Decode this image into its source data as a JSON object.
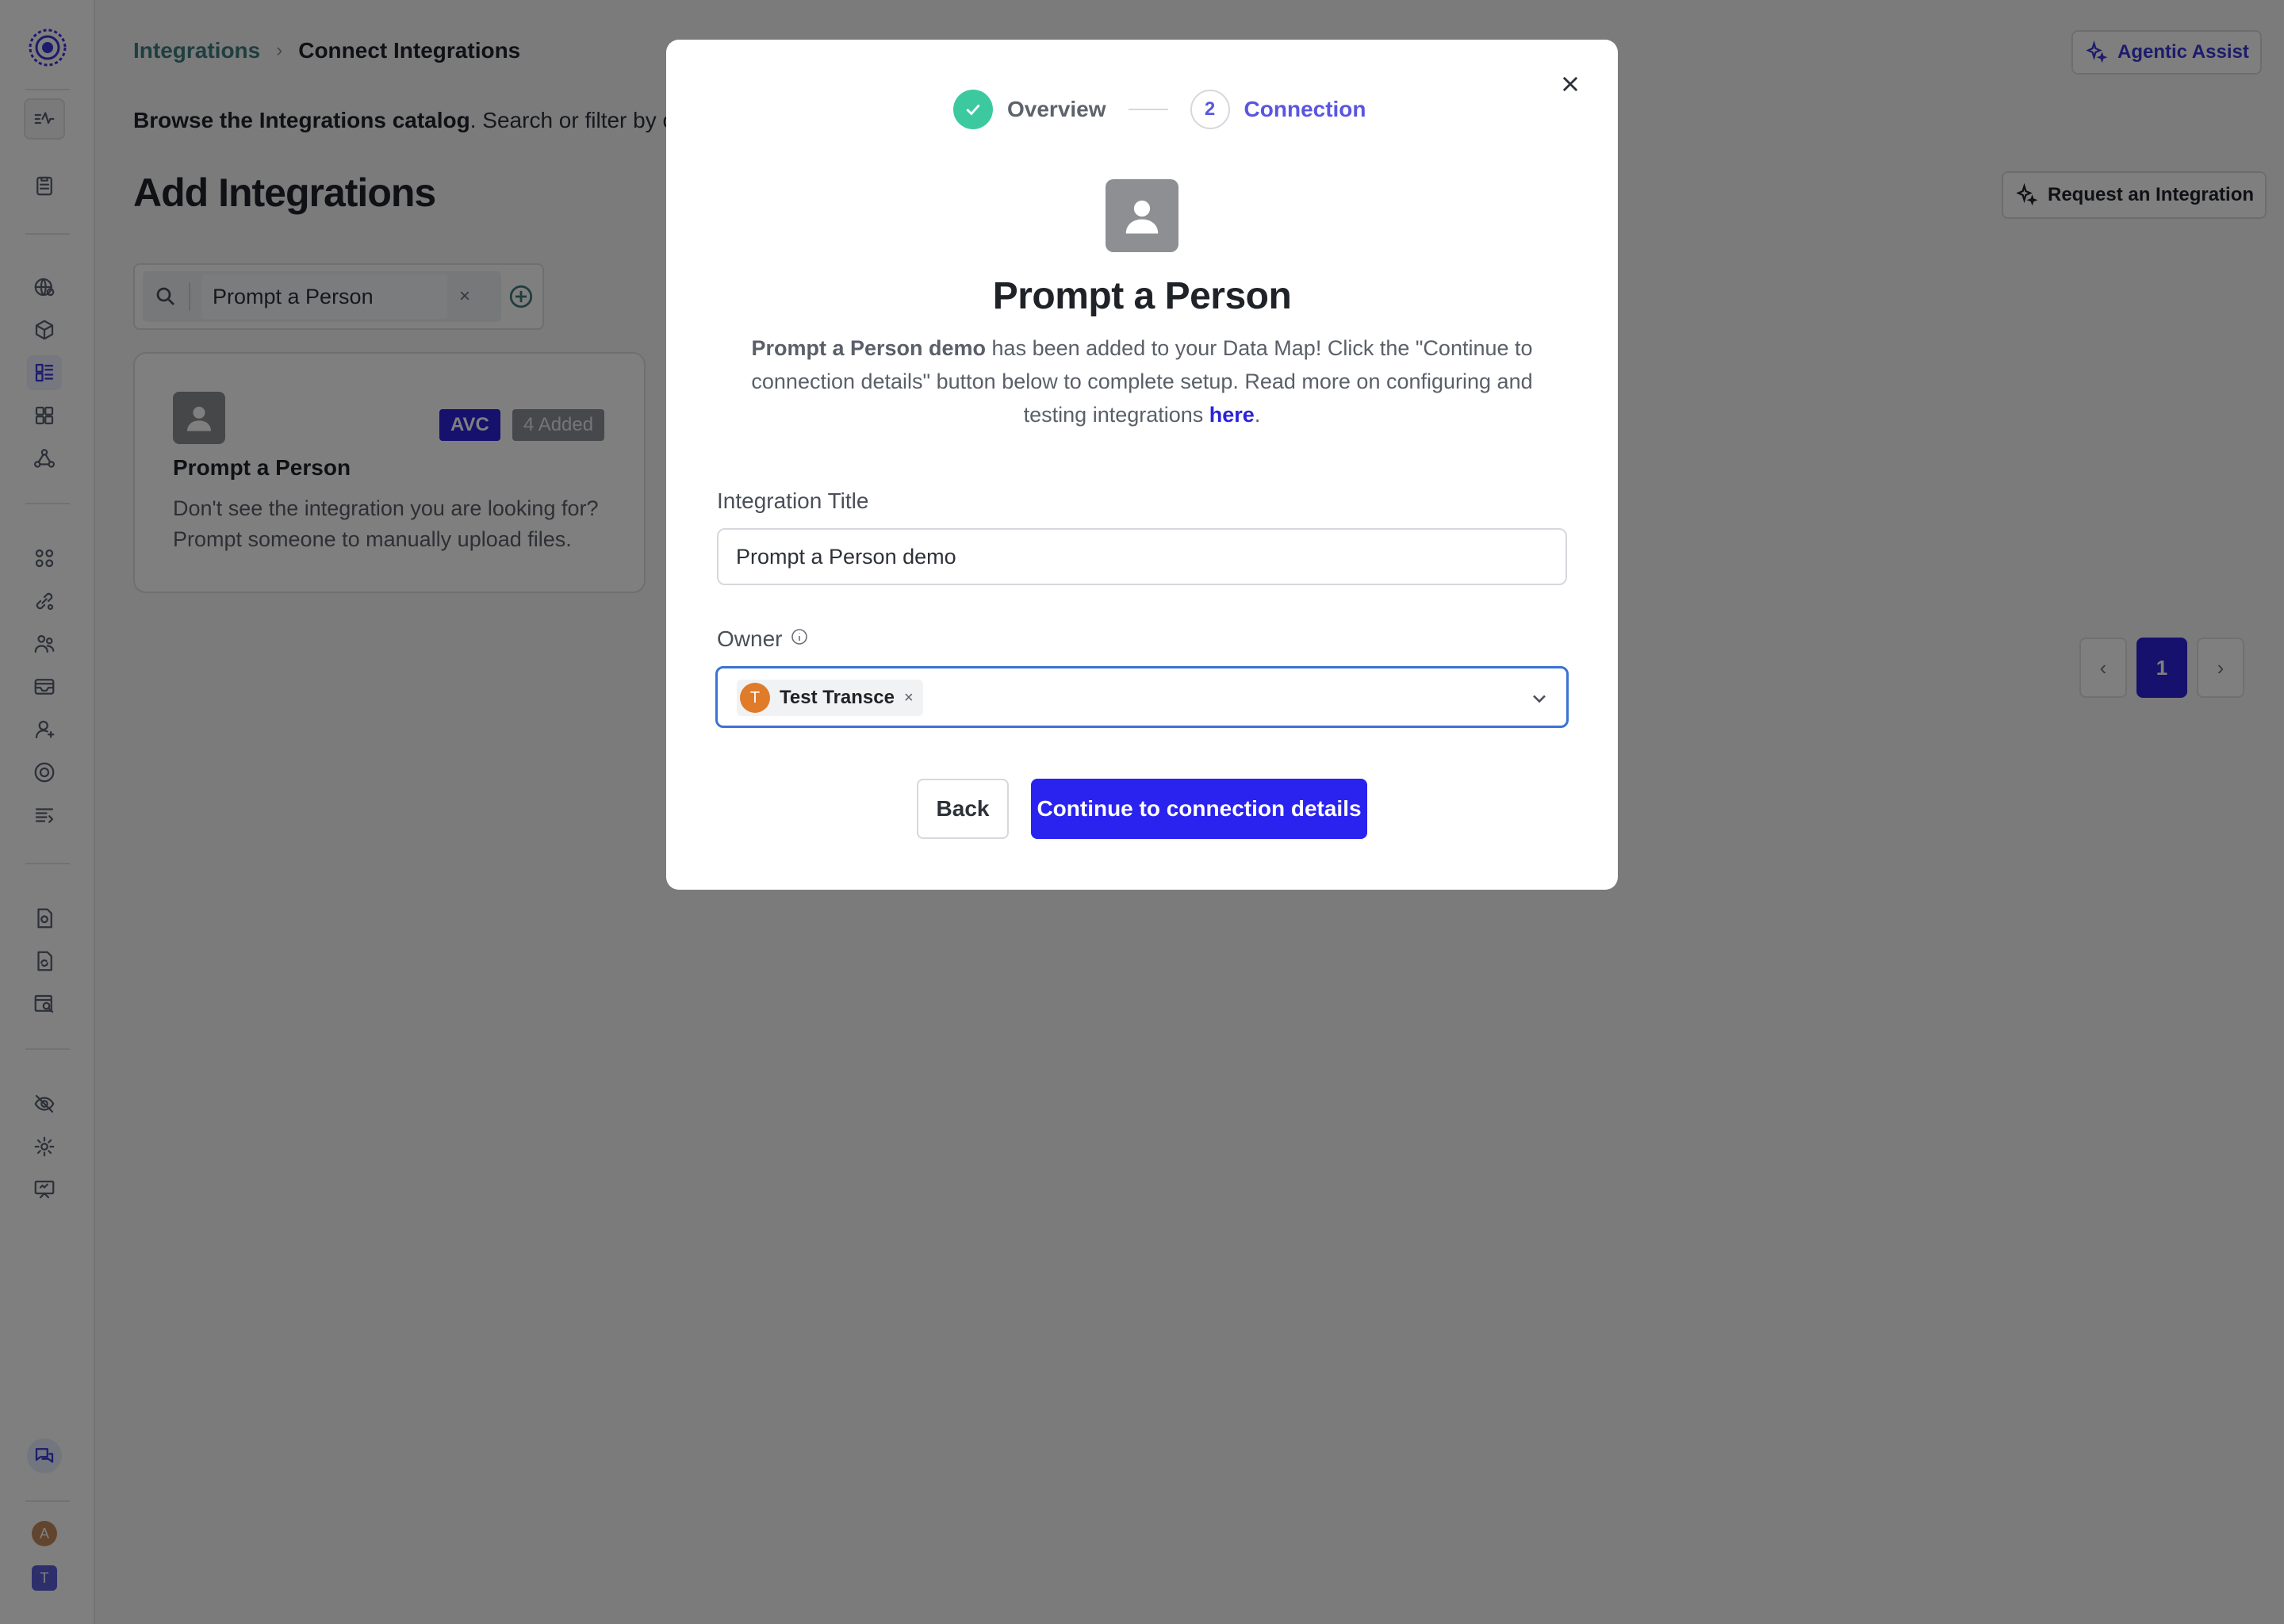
{
  "breadcrumb": {
    "parent": "Integrations",
    "separator": "›",
    "current": "Connect Integrations"
  },
  "header": {
    "agentic_assist_label": "Agentic Assist"
  },
  "intro": {
    "bold": "Browse the Integrations catalog",
    "rest": ". Search or filter by categ"
  },
  "page": {
    "title": "Add Integrations",
    "request_label": "Request an Integration"
  },
  "search": {
    "value": "Prompt a Person",
    "clear_glyph": "×"
  },
  "card": {
    "title": "Prompt a Person",
    "badge_avc": "AVC",
    "badge_added": "4 Added",
    "description": "Don't see the integration you are looking for? Prompt someone to manually upload files."
  },
  "pagination": {
    "prev": "‹",
    "current": "1",
    "next": "›"
  },
  "sidebar": {
    "avatar_a": "A",
    "avatar_t": "T"
  },
  "modal": {
    "steps": [
      {
        "label": "Overview",
        "state": "done"
      },
      {
        "number": "2",
        "label": "Connection",
        "state": "active"
      }
    ],
    "title": "Prompt a Person",
    "desc_bold": "Prompt a Person demo",
    "desc_text": " has been added to your Data Map! Click the \"Continue to connection details\" button below to complete setup. Read more on configuring and testing integrations ",
    "desc_link": "here",
    "desc_end": ".",
    "integration_title_label": "Integration Title",
    "integration_title_value": "Prompt a Person demo",
    "owner_label": "Owner",
    "owner": {
      "initial": "T",
      "name": "Test Transce",
      "remove_glyph": "×"
    },
    "back_label": "Back",
    "continue_label": "Continue to connection details"
  },
  "colors": {
    "accent": "#2a23f0",
    "step_done": "#3dc9a0",
    "step_active": "#5a56e0",
    "owner_avatar": "#e07b2a",
    "breadcrumb_link": "#3e7c80",
    "focus_border": "#3b72d6"
  },
  "icons": [
    "logo-icon",
    "activity-icon",
    "clipboard-icon",
    "globe-icon",
    "cube-icon",
    "catalog-icon",
    "grid-icon",
    "network-icon",
    "apps-icon",
    "link-icon",
    "users-icon",
    "inbox-icon",
    "user-icon",
    "compass-icon",
    "list-icon",
    "doc-shield-icon",
    "doc-sync-icon",
    "search-doc-icon",
    "eye-off-icon",
    "gear-icon",
    "presentation-icon",
    "chat-icon",
    "search-icon",
    "plus-circle-icon",
    "close-icon",
    "check-icon",
    "person-icon",
    "info-icon",
    "chevron-down-icon",
    "sparkle-icon"
  ]
}
